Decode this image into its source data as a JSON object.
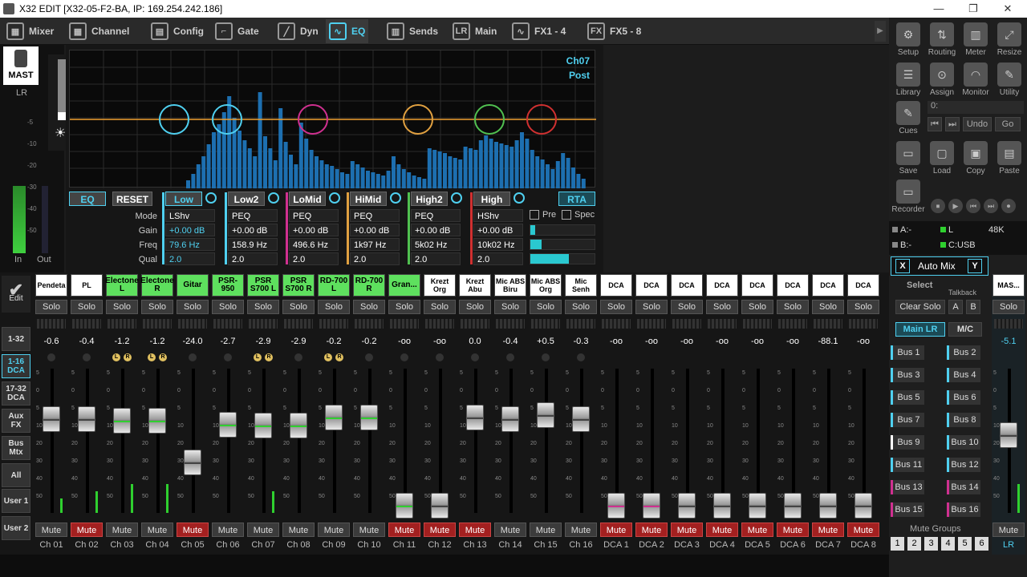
{
  "window": {
    "title": "X32 EDIT [X32-05-F2-BA, IP: 169.254.242.186]",
    "min": "—",
    "max": "❐",
    "close": "✕"
  },
  "nav": {
    "tabs": [
      "Mixer",
      "Channel",
      "Config",
      "Gate",
      "Dyn",
      "EQ",
      "Sends",
      "Main",
      "FX1 - 4",
      "FX5 - 8"
    ],
    "active": "EQ",
    "arrow": "▶"
  },
  "left_panel": {
    "master_label": "MAST",
    "lr_label": "LR",
    "scale": [
      "-5",
      "-10",
      "-20",
      "-30",
      "-40",
      "-50"
    ],
    "in_label": "In",
    "out_label": "Out"
  },
  "eq": {
    "channel": "Ch07",
    "position": "Post",
    "eq_btn": "EQ",
    "reset_btn": "RESET",
    "rta_btn": "RTA",
    "row_labels": [
      "Mode",
      "Gain",
      "Freq",
      "Qual"
    ],
    "bands": [
      {
        "name": "Low",
        "mode": "LShv",
        "gain": "+0.00 dB",
        "freq": "79.6 Hz",
        "q": "2.0",
        "color": "#4fd0f0",
        "active": true
      },
      {
        "name": "Low2",
        "mode": "PEQ",
        "gain": "+0.00 dB",
        "freq": "158.9 Hz",
        "q": "2.0",
        "color": "#4fd0f0",
        "active": false
      },
      {
        "name": "LoMid",
        "mode": "PEQ",
        "gain": "+0.00 dB",
        "freq": "496.6 Hz",
        "q": "2.0",
        "color": "#d03090",
        "active": false
      },
      {
        "name": "HiMid",
        "mode": "PEQ",
        "gain": "+0.00 dB",
        "freq": "1k97 Hz",
        "q": "2.0",
        "color": "#e0a040",
        "active": false
      },
      {
        "name": "High2",
        "mode": "PEQ",
        "gain": "+0.00 dB",
        "freq": "5k02 Hz",
        "q": "2.0",
        "color": "#50c050",
        "active": false
      },
      {
        "name": "High",
        "mode": "HShv",
        "gain": "+0.00 dB",
        "freq": "10k02 Hz",
        "q": "2.0",
        "color": "#d03030",
        "active": false
      }
    ],
    "pre_label": "Pre",
    "spec_label": "Spec",
    "rta_levels": [
      0.08,
      0.18,
      0.6
    ]
  },
  "right_panel": {
    "tools_row1": [
      "Setup",
      "Routing",
      "Meter",
      "Resize"
    ],
    "tools_row2": [
      "Library",
      "Assign",
      "Monitor",
      "Utility"
    ],
    "cues": "Cues",
    "cue_value": "0:",
    "undo": "Undo",
    "go": "Go",
    "tools_row3": [
      "Save",
      "Load",
      "Copy",
      "Paste"
    ],
    "recorder": "Recorder",
    "status": {
      "a": "A:-",
      "l": "L",
      "rate": "48K",
      "b": "B:-",
      "c": "C:USB"
    },
    "x_label": "X",
    "automix": "Auto Mix",
    "y_label": "Y",
    "select_label": "Select",
    "talkback_label": "Talkback",
    "clear_solo": "Clear Solo",
    "tb_a": "A",
    "tb_b": "B",
    "main_lr": "Main LR",
    "mc": "M/C",
    "buses": [
      "Bus 1",
      "Bus 2",
      "Bus 3",
      "Bus 4",
      "Bus 5",
      "Bus 6",
      "Bus 7",
      "Bus 8",
      "Bus 9",
      "Bus 10",
      "Bus 11",
      "Bus 12",
      "Bus 13",
      "Bus 14",
      "Bus 15",
      "Bus 16"
    ],
    "mute_groups_label": "Mute Groups",
    "mute_groups": [
      "1",
      "2",
      "3",
      "4",
      "5",
      "6"
    ]
  },
  "side_buttons": {
    "edit": "Edit",
    "groups": [
      "1-32",
      "1-16 DCA",
      "17-32 DCA",
      "Aux FX",
      "Bus Mtx",
      "All",
      "User 1",
      "User 2"
    ],
    "active": "1-16 DCA"
  },
  "strip_common": {
    "solo": "Solo",
    "mute": "Mute",
    "lr_l": "L",
    "lr_r": "R",
    "fader_ticks": [
      "5",
      "0",
      "5",
      "10",
      "20",
      "30",
      "40",
      "50"
    ]
  },
  "channels": [
    {
      "name": "Pendeta",
      "green": false,
      "db": "-0.6",
      "level": 0.72,
      "meter": 0.1,
      "mute": false,
      "lr": false,
      "label": "Ch 01"
    },
    {
      "name": "PL",
      "green": false,
      "db": "-0.4",
      "level": 0.72,
      "meter": 0.15,
      "mute": true,
      "lr": false,
      "label": "Ch 02"
    },
    {
      "name": "Electone L",
      "green": true,
      "db": "-1.2",
      "level": 0.71,
      "meter": 0.2,
      "mute": false,
      "lr": true,
      "label": "Ch 03"
    },
    {
      "name": "Electone R",
      "green": true,
      "db": "-1.2",
      "level": 0.71,
      "meter": 0.2,
      "mute": false,
      "lr": true,
      "label": "Ch 04"
    },
    {
      "name": "Gitar",
      "green": true,
      "db": "-24.0",
      "level": 0.4,
      "meter": 0.0,
      "mute": true,
      "lr": false,
      "label": "Ch 05"
    },
    {
      "name": "PSR-950",
      "green": true,
      "db": "-2.7",
      "level": 0.68,
      "meter": 0.0,
      "mute": false,
      "lr": false,
      "label": "Ch 06"
    },
    {
      "name": "PSR S700 L",
      "green": true,
      "db": "-2.9",
      "level": 0.67,
      "meter": 0.15,
      "mute": false,
      "lr": true,
      "label": "Ch 07"
    },
    {
      "name": "PSR S700 R",
      "green": true,
      "db": "-2.9",
      "level": 0.67,
      "meter": 0.0,
      "mute": false,
      "lr": false,
      "label": "Ch 08"
    },
    {
      "name": "RD-700 L",
      "green": true,
      "db": "-0.2",
      "level": 0.73,
      "meter": 0.0,
      "mute": false,
      "lr": true,
      "label": "Ch 09"
    },
    {
      "name": "RD-700 R",
      "green": true,
      "db": "-0.2",
      "level": 0.73,
      "meter": 0.0,
      "mute": false,
      "lr": false,
      "label": "Ch 10"
    },
    {
      "name": "Gran...",
      "green": true,
      "db": "-oo",
      "level": 0.08,
      "meter": 0.0,
      "mute": true,
      "lr": false,
      "label": "Ch 11"
    },
    {
      "name": "Krezt Org",
      "green": false,
      "db": "-oo",
      "level": 0.08,
      "meter": 0.0,
      "mute": true,
      "lr": false,
      "label": "Ch 12"
    },
    {
      "name": "Krezt Abu",
      "green": false,
      "db": "0.0",
      "level": 0.73,
      "meter": 0.0,
      "mute": true,
      "lr": false,
      "label": "Ch 13"
    },
    {
      "name": "Mic ABS Biru",
      "green": false,
      "db": "-0.4",
      "level": 0.72,
      "meter": 0.0,
      "mute": false,
      "lr": false,
      "label": "Ch 14"
    },
    {
      "name": "Mic ABS Org",
      "green": false,
      "db": "+0.5",
      "level": 0.75,
      "meter": 0.0,
      "mute": false,
      "lr": false,
      "label": "Ch 15"
    },
    {
      "name": "Mic Senh",
      "green": false,
      "db": "-0.3",
      "level": 0.72,
      "meter": 0.0,
      "mute": false,
      "lr": false,
      "label": "Ch 16"
    },
    {
      "name": "DCA",
      "green": false,
      "db": "-oo",
      "level": 0.08,
      "meter": 0.0,
      "mute": true,
      "lr": false,
      "label": "DCA 1"
    },
    {
      "name": "DCA",
      "green": false,
      "db": "-oo",
      "level": 0.08,
      "meter": 0.0,
      "mute": true,
      "lr": false,
      "label": "DCA 2"
    },
    {
      "name": "DCA",
      "green": false,
      "db": "-oo",
      "level": 0.08,
      "meter": 0.0,
      "mute": true,
      "lr": false,
      "label": "DCA 3"
    },
    {
      "name": "DCA",
      "green": false,
      "db": "-oo",
      "level": 0.08,
      "meter": 0.0,
      "mute": true,
      "lr": false,
      "label": "DCA 4"
    },
    {
      "name": "DCA",
      "green": false,
      "db": "-oo",
      "level": 0.08,
      "meter": 0.0,
      "mute": true,
      "lr": false,
      "label": "DCA 5"
    },
    {
      "name": "DCA",
      "green": false,
      "db": "-oo",
      "level": 0.08,
      "meter": 0.0,
      "mute": true,
      "lr": false,
      "label": "DCA 6"
    },
    {
      "name": "DCA",
      "green": false,
      "db": "-88.1",
      "level": 0.08,
      "meter": 0.0,
      "mute": true,
      "lr": false,
      "label": "DCA 7"
    },
    {
      "name": "DCA",
      "green": false,
      "db": "-oo",
      "level": 0.08,
      "meter": 0.0,
      "mute": true,
      "lr": false,
      "label": "DCA 8"
    }
  ],
  "master": {
    "name": "MAS...",
    "db": "-5.1",
    "level": 0.6,
    "meter": 0.2,
    "mute": false,
    "label": "LR"
  }
}
